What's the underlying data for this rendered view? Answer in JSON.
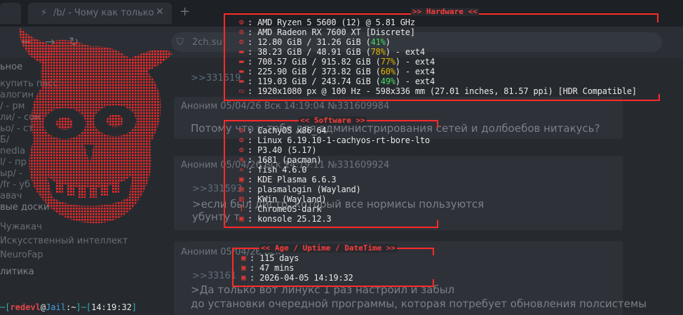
{
  "browser": {
    "tabs": [
      {
        "title": "/b/ - Чому как только"
      }
    ],
    "url": "2ch.su",
    "sidebar": [
      {
        "text": "ьное",
        "heading": true
      },
      {
        "text": "купить пасс",
        "heading": false
      },
      {
        "text": "алогин",
        "heading": false
      },
      {
        "text": "/ - рм",
        "heading": false
      },
      {
        "text": "ли/ - сон",
        "heading": false
      },
      {
        "text": "ьо/ - ст",
        "heading": false
      },
      {
        "text": "Б/",
        "heading": false
      },
      {
        "text": "nedia",
        "heading": false
      },
      {
        "text": "l/ - пр",
        "heading": false
      },
      {
        "text": "ыр/ -",
        "heading": false
      },
      {
        "text": "/fr - уб",
        "heading": false
      },
      {
        "text": "авач",
        "heading": false
      },
      {
        "text": "вые доски",
        "heading": true
      },
      {
        "text": "Чужакач",
        "heading": false
      },
      {
        "text": "Искусственный интеллект",
        "heading": false
      },
      {
        "text": "NeuroFap",
        "heading": false
      },
      {
        "text": "литика",
        "heading": true
      }
    ],
    "posts": [
      {
        "text": ">>331619",
        "kind": "link"
      },
      {
        "text": "Аноним 05/04/26 Вск 14:19:04 №331609984",
        "kind": "meta"
      },
      {
        "text": "Потому что у тебя для администрирования сетей и долбоебов нитакусь?",
        "kind": "big"
      },
      {
        "text": "Аноним 05/04/26 Вск 14:19:11 №331609924",
        "kind": "meta"
      },
      {
        "text": ">>331593",
        "kind": "link"
      },
      {
        "text": ">если был дистр, который все нормисы пользуются",
        "kind": "big"
      },
      {
        "text": "убунту т",
        "kind": "big"
      },
      {
        "text": "Аноним 05/04/26 Вск",
        "kind": "meta"
      },
      {
        "text": ">>33161",
        "kind": "link"
      },
      {
        "text": ">Да только вот линукс 1 раз настроил и забыл",
        "kind": "big"
      },
      {
        "text": "до установки очередной программы, которая потребует обновления полсистемы",
        "kind": "big"
      }
    ]
  },
  "hardware": {
    "title": ">> Hardware <<",
    "rows": [
      {
        "icon": "cpu-icon",
        "text": "AMD Ryzen 5 5600 (12) @ 5.81 GHz"
      },
      {
        "icon": "gpu-icon",
        "text": "AMD Radeon RX 7600 XT [Discrete]"
      },
      {
        "icon": "memory-icon",
        "pre": "12.80 GiB / 31.26 GiB (",
        "pct": "41%",
        "post": ")",
        "pct_color": "green"
      },
      {
        "icon": "disk-icon",
        "pre": "38.23 GiB / 48.91 GiB (",
        "pct": "78%",
        "post": ") - ext4",
        "pct_color": "yellow"
      },
      {
        "icon": "disk-icon",
        "pre": "708.57 GiB / 915.82 GiB (",
        "pct": "77%",
        "post": ") - ext4",
        "pct_color": "yellow"
      },
      {
        "icon": "disk-icon",
        "pre": "225.90 GiB / 373.82 GiB (",
        "pct": "60%",
        "post": ") - ext4",
        "pct_color": "yellow"
      },
      {
        "icon": "disk-icon",
        "pre": "119.03 GiB / 243.74 GiB (",
        "pct": "49%",
        "post": ") - ext4",
        "pct_color": "green"
      },
      {
        "icon": "display-icon",
        "text": "1920x1080 px @ 100 Hz - 598x336 mm (27.01 inches, 81.57 ppi) [HDR Compatible]"
      }
    ]
  },
  "software": {
    "title": "<< Software >>",
    "rows": [
      {
        "icon": "os-icon",
        "text": "CachyOS x86_64"
      },
      {
        "icon": "kernel-icon",
        "text": "Linux 6.19.10-1-cachyos-rt-bore-lto"
      },
      {
        "icon": "gear-icon",
        "text": "P3.40 (5.17)"
      },
      {
        "icon": "package-icon",
        "text": "1681 (pacman)"
      },
      {
        "icon": "shell-icon",
        "text": "fish 4.6.0"
      },
      {
        "icon": "desktop-icon",
        "text": "KDE Plasma 6.6.3"
      },
      {
        "icon": "window-icon",
        "text": "plasmalogin (Wayland)"
      },
      {
        "icon": "window-manager-icon",
        "text": "KWin (Wayland)"
      },
      {
        "icon": "theme-icon",
        "text": "ChromeOS-dark"
      },
      {
        "icon": "terminal-icon",
        "text": "konsole 25.12.3"
      }
    ]
  },
  "uptime": {
    "title": "<< Age / Uptime / DateTime >>",
    "rows": [
      {
        "icon": "terminal-icon",
        "text": "115 days"
      },
      {
        "icon": "terminal-icon",
        "text": "47 mins"
      },
      {
        "icon": "terminal-icon",
        "text": "2026-04-05 14:19:32"
      }
    ]
  },
  "prompt": {
    "user": "redevl",
    "host": "Jail",
    "path": "~",
    "time": "14:19:32"
  },
  "colors": {
    "accent": "#ff3b3b",
    "pct_yellow": "#e2b300",
    "pct_green": "#4cd964"
  }
}
